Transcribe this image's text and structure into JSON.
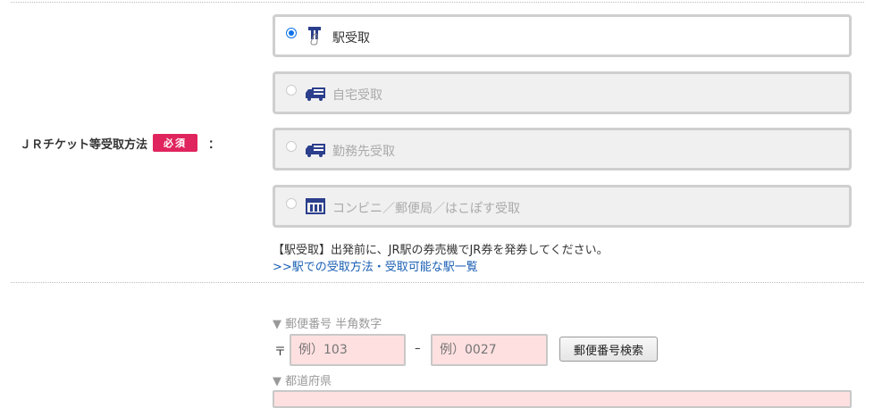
{
  "form": {
    "ticket_method_label": "ＪＲチケット等受取方法",
    "required_badge": "必須",
    "colon": "：",
    "options": [
      {
        "label": "駅受取",
        "selected": true,
        "enabled": true,
        "icon": "station-gate-icon"
      },
      {
        "label": "自宅受取",
        "selected": false,
        "enabled": false,
        "icon": "delivery-truck-icon"
      },
      {
        "label": "勤務先受取",
        "selected": false,
        "enabled": false,
        "icon": "delivery-truck-icon"
      },
      {
        "label": "コンビニ／郵便局／はこぽす受取",
        "selected": false,
        "enabled": false,
        "icon": "store-icon"
      }
    ],
    "note": "【駅受取】出発前に、JR駅の券売機でJR券を発券してください。",
    "link": ">>駅での受取方法・受取可能な駅一覧"
  },
  "address": {
    "postal_label": "▼ 郵便番号 半角数字",
    "postal_mark": "〒",
    "postal1_placeholder": "例）103",
    "dash": "–",
    "postal2_placeholder": "例）0027",
    "search_button": "郵便番号検索",
    "prefecture_label": "▼ 都道府県"
  },
  "colors": {
    "accent": "#0a72e8",
    "required": "#e0245e",
    "icon_navy": "#2b3f8c",
    "input_bg": "#ffe0e0",
    "link": "#1a5fb4"
  }
}
